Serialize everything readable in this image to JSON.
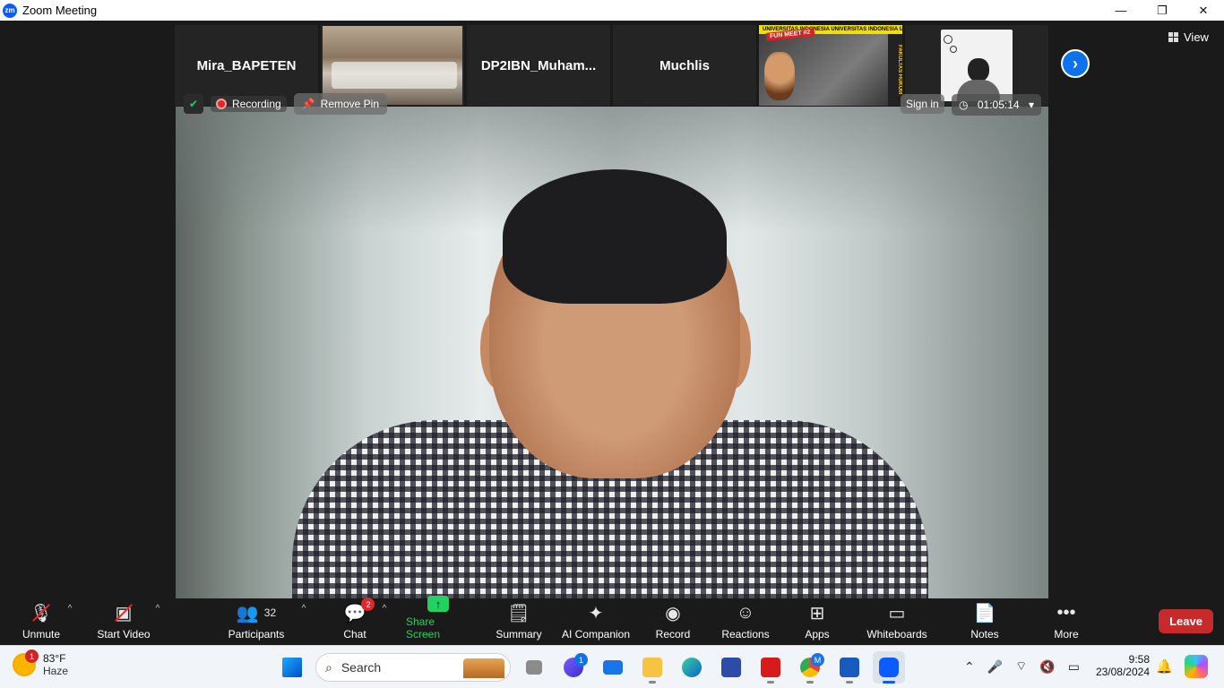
{
  "window": {
    "title": "Zoom Meeting",
    "logo": "zm"
  },
  "window_controls": {
    "minimize": "—",
    "restore": "❐",
    "close": "✕"
  },
  "gallery_strip": {
    "tiles": [
      {
        "type": "name",
        "label": "Mira_BAPETEN"
      },
      {
        "type": "video",
        "description_icon": "meeting-room-video"
      },
      {
        "type": "name",
        "label": "DP2IBN_Muham..."
      },
      {
        "type": "name",
        "label": "Muchlis"
      },
      {
        "type": "video",
        "banner": "UNIVERSITAS INDONESIA UNIVERSITAS INDONESIA UNIVERS",
        "badge": "FUN MEET #2",
        "side": "FAKULTAS HUKUM"
      },
      {
        "type": "avatar"
      }
    ],
    "next_icon": "chevron-right-icon",
    "view_label": "View"
  },
  "main_video": {
    "recording_label": "Recording",
    "remove_pin_label": "Remove Pin",
    "sign_in_label": "Sign in",
    "timer": "01:05:14"
  },
  "toolbar": {
    "unmute": "Unmute",
    "start_video": "Start Video",
    "participants": "Participants",
    "participants_count": "32",
    "chat": "Chat",
    "chat_badge": "2",
    "share_screen": "Share Screen",
    "summary": "Summary",
    "ai_companion": "AI Companion",
    "record": "Record",
    "reactions": "Reactions",
    "apps": "Apps",
    "whiteboards": "Whiteboards",
    "notes": "Notes",
    "more": "More",
    "leave": "Leave"
  },
  "taskbar": {
    "weather_temp": "83°F",
    "weather_desc": "Haze",
    "weather_badge": "1",
    "search_placeholder": "Search",
    "meet_badge": "1",
    "chrome_badge": "M",
    "time": "9:58",
    "date": "23/08/2024"
  },
  "colors": {
    "accent": "#0e72ed",
    "share_green": "#23d160",
    "leave_red": "#c62a2a"
  }
}
